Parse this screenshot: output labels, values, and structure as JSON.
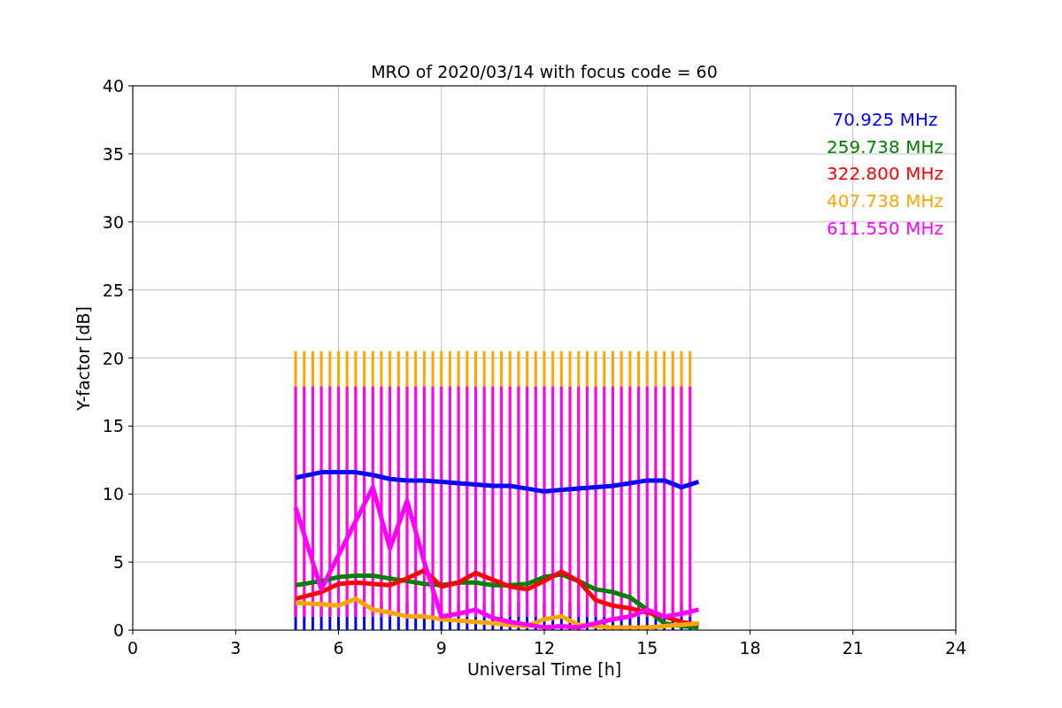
{
  "chart_data": {
    "type": "line",
    "title": "MRO of 2020/03/14 with focus code = 60",
    "xlabel": "Universal Time [h]",
    "ylabel": "Y-factor [dB]",
    "x": [
      4.75,
      5.5,
      6,
      6.5,
      7,
      7.5,
      8,
      8.5,
      9,
      9.5,
      10,
      10.5,
      11,
      11.5,
      12,
      12.5,
      13,
      13.5,
      14,
      14.5,
      15,
      15.5,
      16,
      16.5
    ],
    "series": [
      {
        "name": "70.925 MHz",
        "color": "#0000ff",
        "values": [
          11.2,
          11.6,
          11.6,
          11.6,
          11.4,
          11.1,
          11.0,
          11.0,
          10.9,
          10.8,
          10.7,
          10.6,
          10.6,
          10.4,
          10.2,
          10.3,
          10.4,
          10.5,
          10.6,
          10.8,
          11.0,
          11.0,
          10.5,
          10.9
        ]
      },
      {
        "name": "259.738 MHz",
        "color": "#008000",
        "values": [
          3.3,
          3.6,
          3.9,
          4.0,
          4.0,
          3.8,
          3.6,
          3.4,
          3.3,
          3.5,
          3.5,
          3.3,
          3.3,
          3.4,
          3.9,
          4.1,
          3.6,
          3.0,
          2.8,
          2.4,
          1.5,
          0.5,
          0.3,
          0.2
        ]
      },
      {
        "name": "322.800 MHz",
        "color": "#ff0000",
        "values": [
          2.3,
          2.8,
          3.4,
          3.5,
          3.4,
          3.3,
          3.8,
          4.4,
          3.2,
          3.5,
          4.2,
          3.7,
          3.2,
          3.0,
          3.6,
          4.3,
          3.6,
          2.2,
          1.8,
          1.6,
          1.3,
          1.0,
          0.6,
          0.4
        ]
      },
      {
        "name": "407.738 MHz",
        "color": "#ffa500",
        "values": [
          2.0,
          1.9,
          1.8,
          2.3,
          1.5,
          1.3,
          1.0,
          1.0,
          0.8,
          0.7,
          0.6,
          0.5,
          0.4,
          0.3,
          0.8,
          1.0,
          0.4,
          0.3,
          0.2,
          0.2,
          0.2,
          0.3,
          0.4,
          0.5
        ]
      },
      {
        "name": "611.550 MHz",
        "color": "#ff00ff",
        "values": [
          9.0,
          3.0,
          5.5,
          8.0,
          10.5,
          6.0,
          9.5,
          5.0,
          1.0,
          1.2,
          1.5,
          0.9,
          0.6,
          0.4,
          0.2,
          0.3,
          0.2,
          0.5,
          0.8,
          1.0,
          1.5,
          1.0,
          1.2,
          1.5
        ]
      }
    ],
    "xlim": [
      0,
      24
    ],
    "ylim": [
      0,
      40
    ],
    "xticks": [
      0,
      3,
      6,
      9,
      12,
      15,
      18,
      21,
      24
    ],
    "yticks": [
      0,
      5,
      10,
      15,
      20,
      25,
      30,
      35,
      40
    ],
    "grid": true
  }
}
